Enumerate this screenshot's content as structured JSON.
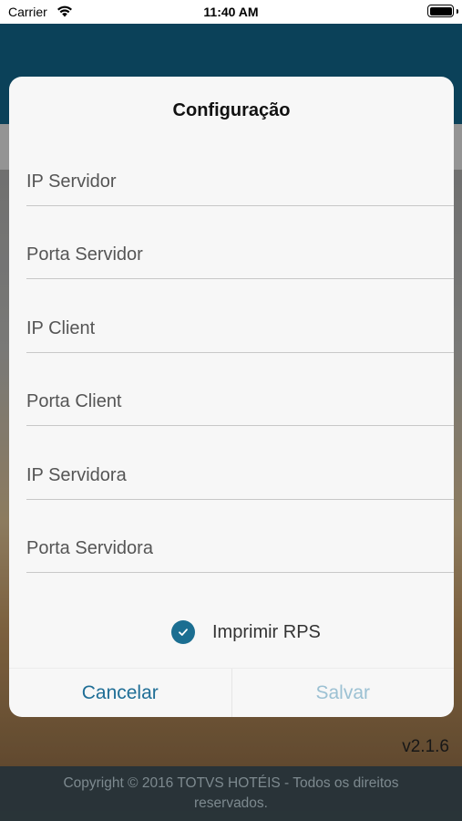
{
  "status_bar": {
    "carrier": "Carrier",
    "time": "11:40 AM",
    "wifi_icon": "wifi-icon",
    "battery_icon": "battery-icon"
  },
  "dialog": {
    "title": "Configuração",
    "fields": [
      {
        "placeholder": "IP Servidor",
        "value": ""
      },
      {
        "placeholder": "Porta Servidor",
        "value": ""
      },
      {
        "placeholder": "IP Client",
        "value": ""
      },
      {
        "placeholder": "Porta Client",
        "value": ""
      },
      {
        "placeholder": "IP Servidora",
        "value": ""
      },
      {
        "placeholder": "Porta Servidora",
        "value": ""
      }
    ],
    "checkbox": {
      "label": "Imprimir RPS",
      "checked": true,
      "color": "#1b6e91"
    },
    "cancel_label": "Cancelar",
    "save_label": "Salvar"
  },
  "app": {
    "version": "v2.1.6",
    "footer": "Copyright © 2016 TOTVS HOTÉIS - Todos os direitos reservados.",
    "header_color": "#0d4a66"
  }
}
